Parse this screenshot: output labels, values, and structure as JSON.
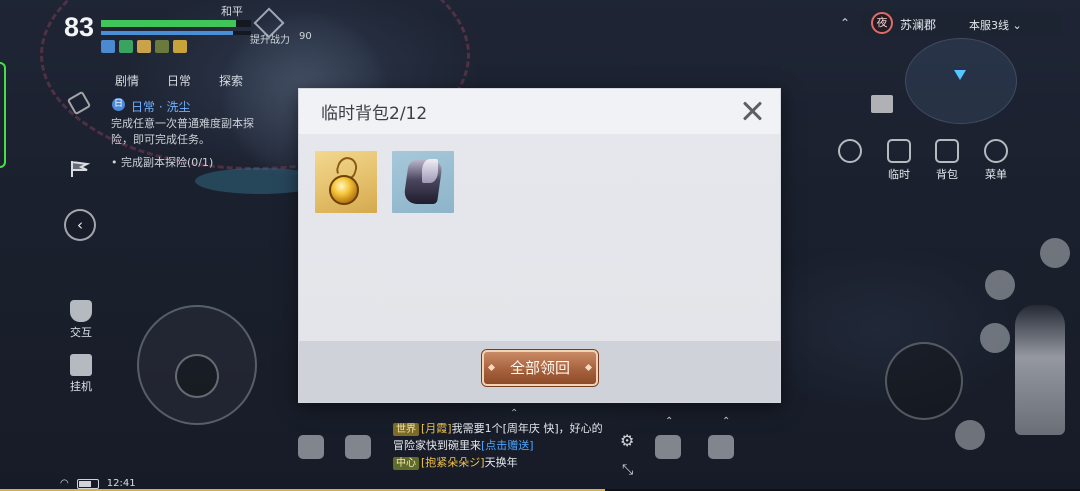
{
  "hud": {
    "level": "83",
    "hp_fraction": 0.9,
    "mp_fraction": 0.88,
    "status": "和平",
    "power_label": "提升战力",
    "power_value": "90"
  },
  "task": {
    "tabs": [
      "剧情",
      "日常",
      "探索"
    ],
    "badge": "日",
    "title": "日常 · 洗尘",
    "description": "完成任意一次普通难度副本探险，即可完成任务。",
    "progress": "• 完成副本探险(0/1)"
  },
  "left_tools": {
    "interact_label": "交互",
    "idle_label": "挂机"
  },
  "location": {
    "night_badge": "夜",
    "area": "苏澜郡",
    "server": "本服3线"
  },
  "right_buttons": {
    "temp_label": "临时",
    "bag_label": "背包",
    "menu_label": "菜单"
  },
  "chat": {
    "lines": [
      {
        "tag": "世界",
        "name": "[月霞]",
        "text": "我需要1个[周年庆 快]，好心的"
      },
      {
        "tag": "",
        "name": "",
        "text": "冒险家快到碗里来",
        "link": "[点击赠送]"
      },
      {
        "tag": "中心",
        "name": "[抱紧朵朵ジ]",
        "text": "天换年"
      }
    ]
  },
  "system": {
    "time": "12:41"
  },
  "modal": {
    "title": "临时背包2/12",
    "items": [
      {
        "name": "amulet",
        "icon": "amulet-icon"
      },
      {
        "name": "boots",
        "icon": "boots-icon"
      }
    ],
    "claim_all_label": "全部领回"
  },
  "colors": {
    "claim_button": "#a7623d",
    "hp_bar": "#3fc55a",
    "mp_bar": "#4a8fd6",
    "modal_bg": "#eceef2"
  }
}
